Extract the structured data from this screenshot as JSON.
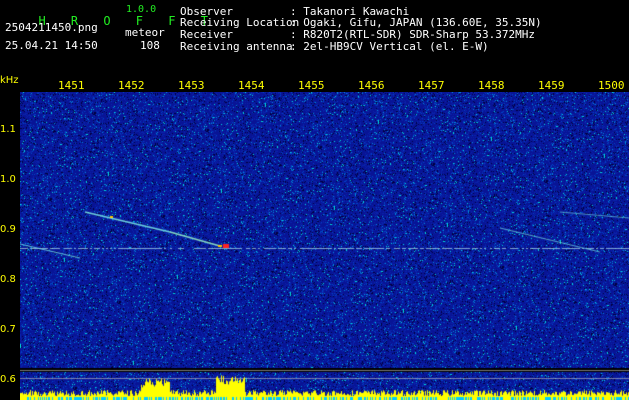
{
  "header": {
    "title": "H R O F F T",
    "version": "1.0.0",
    "filename": "2504211450.png",
    "datetime": "25.04.21 14:50",
    "event_type": "meteor",
    "event_count": "108",
    "observer_label": "Observer",
    "observer_value": ": Takanori Kawachi",
    "location_label": "Receiving Location",
    "location_value": ": Ogaki, Gifu, JAPAN (136.60E, 35.35N)",
    "receiver_label": "Receiver",
    "receiver_value": ": R820T2(RTL-SDR) SDR-Sharp 53.372MHz",
    "antenna_label": "Receiving antenna",
    "antenna_value": ": 2el-HB9CV Vertical (el. E-W)"
  },
  "axis": {
    "unit": "kHz",
    "time_ticks": [
      "1451",
      "1452",
      "1453",
      "1454",
      "1455",
      "1456",
      "1457",
      "1458",
      "1459",
      "1500"
    ],
    "freq_ticks": [
      "1.1",
      "1.0",
      "0.9",
      "0.8",
      "0.7",
      "0.6"
    ]
  },
  "colors": {
    "background": "#000000",
    "label": "#ffff00",
    "title": "#22ee22",
    "text": "#ffffff",
    "noise_base": "#0a1aa0",
    "echo": "#ff2020"
  }
}
